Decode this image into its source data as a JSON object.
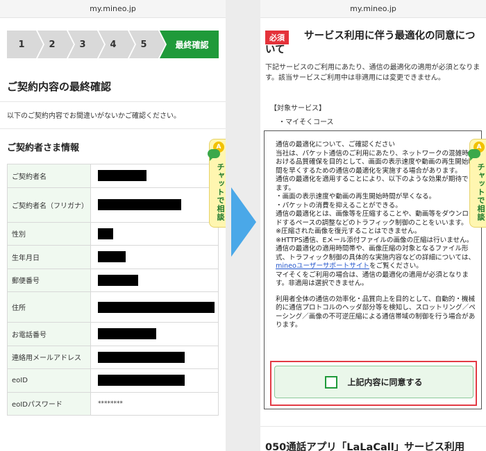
{
  "left": {
    "url": "my.mineo.jp",
    "steps": [
      "1",
      "2",
      "3",
      "4",
      "5"
    ],
    "step_final": "最終確認",
    "title": "ご契約内容の最終確認",
    "subtitle": "以下のご契約内容でお間違いがないかご確認ください。",
    "section": "ご契約者さま情報",
    "rows": [
      {
        "label": "ご契約者名",
        "value": "",
        "redact_w": 70
      },
      {
        "label": "ご契約者名（フリガナ）",
        "value": "",
        "redact_w": 120
      },
      {
        "label": "性別",
        "value": "",
        "redact_w": 22
      },
      {
        "label": "生年月日",
        "value": "",
        "redact_w": 40
      },
      {
        "label": "郵便番号",
        "value": "",
        "redact_w": 58
      },
      {
        "label": "住所",
        "value": "",
        "redact_w": 168
      },
      {
        "label": "お電話番号",
        "value": "",
        "redact_w": 84
      },
      {
        "label": "連絡用メールアドレス",
        "value": "",
        "redact_w": 125
      },
      {
        "label": "eoID",
        "value": "",
        "redact_w": 125
      },
      {
        "label": "eoIDパスワード",
        "value": "********",
        "redact_w": 0
      }
    ],
    "chat": {
      "badge": "A",
      "label": "チャットで相談"
    }
  },
  "right": {
    "url": "my.mineo.jp",
    "required_badge": "必須",
    "title": "サービス利用に伴う最適化の同意について",
    "description": "下記サービスのご利用にあたり、通信の最適化の適用が必須となります。該当サービスご利用中は非適用には変更できません。",
    "services_label": "【対象サービス】",
    "service_item": "・マイそくコース",
    "notice": {
      "p1": "通信の最適化について、ご確認ください",
      "p2": "当社は、パケット通信のご利用にあたり、ネットワークの混雑時における品質確保を目的として、画面の表示速度や動画の再生開始時間を早くするための通信の最適化を実施する場合があります。",
      "p3": "通信の最適化を適用することにより、以下のような効果が期待できます。",
      "p4": "・画面の表示速度や動画の再生開始時間が早くなる。",
      "p5": "・パケットの消費を抑えることができる。",
      "p6": "通信の最適化とは、画像等を圧縮することや、動画等をダウンロードするペースの調整などのトラフィック制御のことをいいます。",
      "p7": "※圧縮された画像を復元することはできません。",
      "p8": "※HTTPS通信、Eメール添付ファイルの画像の圧縮は行いません。",
      "p9a": "通信の最適化の適用時間帯や、画像圧縮の対象となるファイル形式、トラフィック制御の具体的な実施内容などの詳細については、",
      "p9link": "mineoユーザーサポートサイト",
      "p9b": "をご覧ください。",
      "p10": "マイそくをご利用の場合は、通信の最適化の適用が必須となります。非適用は選択できません。",
      "p11": "利用者全体の通信の効率化・品質向上を目的として、自動的・機械的に通信プロトコルのヘッダ部分等を検知し、スロットリング／ペーシング／画像の不可逆圧縮による通信帯域の制御を行う場合があります。"
    },
    "agree_label": "上記内容に同意する",
    "next_section_title": "050通話アプリ「LaLaCall」サービス利用",
    "chat": {
      "badge": "A",
      "label": "チャットで相談"
    }
  }
}
